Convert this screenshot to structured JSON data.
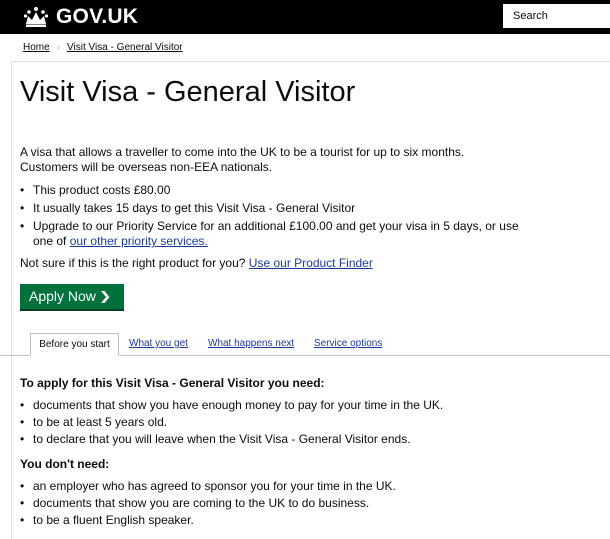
{
  "header": {
    "logo_text": "GOV.UK",
    "logo_icon": "crown-icon",
    "search_placeholder": "Search",
    "bar_color": "#000000"
  },
  "breadcrumb": {
    "home": "Home",
    "separator": "›",
    "current": "Visit Visa - General Visitor"
  },
  "page": {
    "title": "Visit Visa - General Visitor",
    "intro": "A visa that allows a traveller to come into the UK to be a tourist for up to six months. Customers will be overseas non-EEA nationals.",
    "facts": [
      "This product costs £80.00",
      "It usually takes 15 days to get this Visit Visa - General Visitor",
      "Upgrade to our Priority Service for an additional £100.00 and get your visa in 5 days, or use one of"
    ],
    "priority_link": "our other priority services.",
    "finder_text": "Not sure if this is the right product for you?",
    "finder_link": "Use our Product Finder",
    "apply_label": "Apply Now",
    "apply_color": "#00703c"
  },
  "tabs": [
    {
      "label": "Before you start",
      "active": true
    },
    {
      "label": "What you get",
      "active": false
    },
    {
      "label": "What happens next",
      "active": false
    },
    {
      "label": "Service options",
      "active": false
    }
  ],
  "content": {
    "need_heading": "To apply for this Visit Visa - General Visitor you need:",
    "needs": [
      "documents that show you have enough money to pay for your time in the UK.",
      "to be at least 5 years old.",
      "to declare that you will leave when the Visit Visa - General Visitor ends."
    ],
    "dont_need_heading": "You don't need:",
    "dont_needs": [
      "an employer who has agreed to sponsor you for your time in the UK.",
      "documents that show you are coming to the UK to do business.",
      "to be a fluent English speaker."
    ]
  }
}
